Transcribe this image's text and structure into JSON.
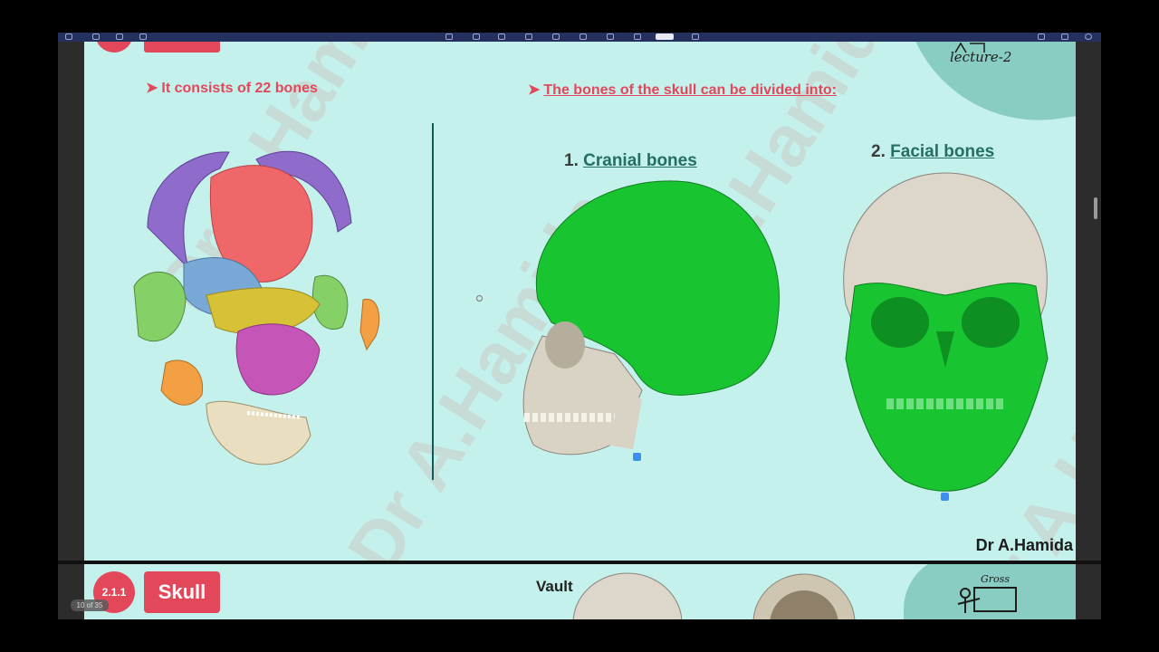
{
  "viewer": {
    "page_counter": "10 of 35"
  },
  "slide1": {
    "lecture_tag": "lecture-2",
    "bullet_left": "It consists of 22 bones",
    "bullet_right": "The bones of the skull can be divided into:",
    "cranial": {
      "number": "1.",
      "label": "Cranial bones"
    },
    "facial": {
      "number": "2.",
      "label": "Facial bones"
    },
    "watermark": "Dr A.Hamida",
    "signature": "Dr A.Hamida"
  },
  "slide2": {
    "badge_number": "2.1.1",
    "badge_title": "Skull",
    "vault_label": "Vault",
    "gross_tag": "Gross"
  },
  "colors": {
    "slide_bg": "#c4f1ec",
    "accent_red": "#e2485a",
    "cranial_green": "#19c431",
    "deco_teal": "#7fc7bb",
    "toolbar": "#24315f"
  },
  "icons": [
    "arrow-bullet-icon",
    "exploded-skull-illustration",
    "lateral-skull-illustration",
    "frontal-skull-illustration",
    "teacher-board-icon"
  ]
}
